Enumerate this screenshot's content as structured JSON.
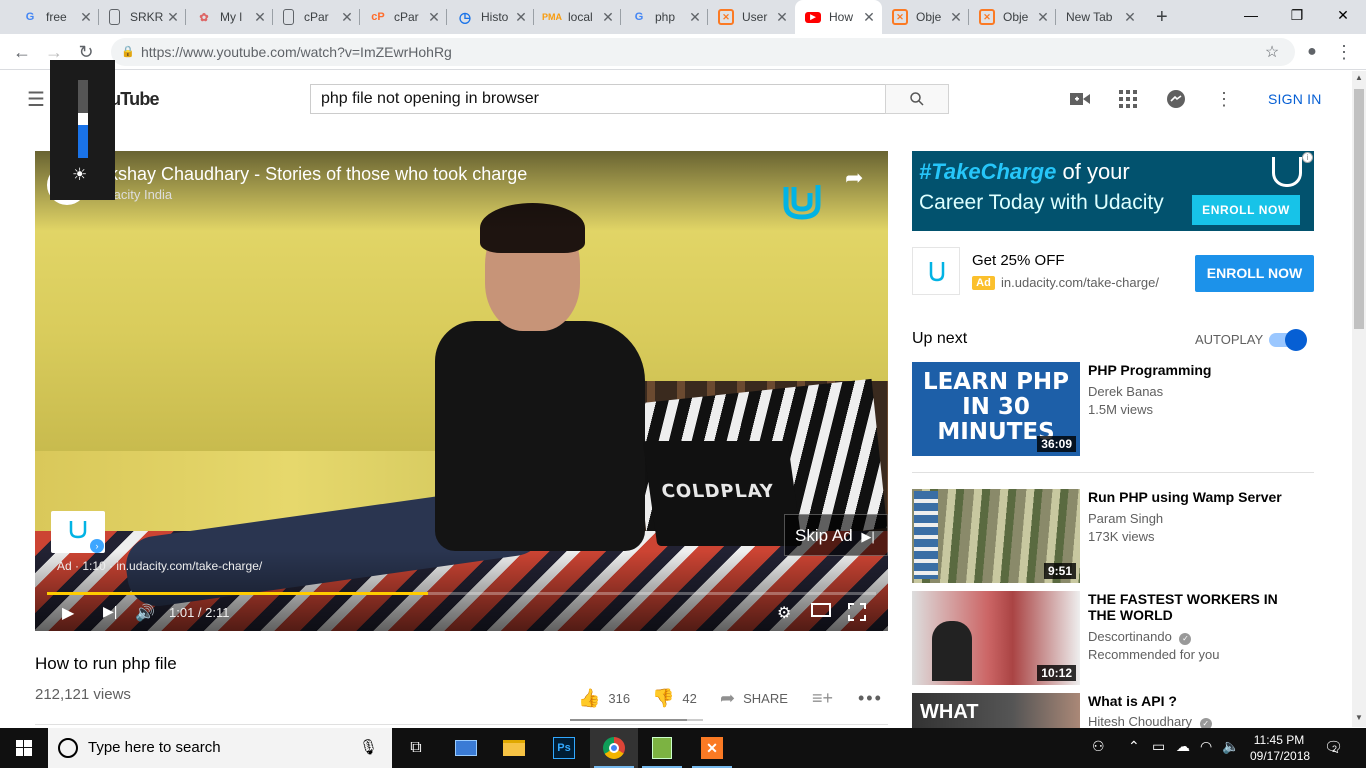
{
  "browser": {
    "tabs": [
      {
        "title": "free",
        "favicon": "google-icon"
      },
      {
        "title": "SRKR",
        "favicon": "doc-icon"
      },
      {
        "title": "My l",
        "favicon": "myicon"
      },
      {
        "title": "cPar",
        "favicon": "doc-icon"
      },
      {
        "title": "cPar",
        "favicon": "cpanel-icon"
      },
      {
        "title": "Histo",
        "favicon": "history-icon"
      },
      {
        "title": "local",
        "favicon": "phpmyadmin-icon"
      },
      {
        "title": "php",
        "favicon": "google-icon"
      },
      {
        "title": "User",
        "favicon": "xampp-icon"
      },
      {
        "title": "How",
        "favicon": "youtube-icon"
      },
      {
        "title": "Obje",
        "favicon": "xampp-icon"
      },
      {
        "title": "Obje",
        "favicon": "xampp-icon"
      },
      {
        "title": "New Tab",
        "favicon": "none"
      }
    ],
    "url": "https://www.youtube.com/watch?v=ImZEwrHohRg"
  },
  "youtube": {
    "logo_text": "YouTube",
    "search_value": "php file not opening in browser",
    "signin_label": "SIGN IN"
  },
  "player": {
    "ad_title": "Akshay Chaudhary - Stories of those who took charge",
    "ad_channel": "Udacity India",
    "skip_label": "Skip Ad",
    "ad_text": "Ad · 1:10 · in.udacity.com/take-charge/",
    "time": "1:01 / 2:11",
    "progress_fraction": 0.46
  },
  "brightness_level": 0.42,
  "video": {
    "title": "How to run php file",
    "views": "212,121 views",
    "likes": "316",
    "dislikes": "42",
    "share_label": "SHARE",
    "like_fraction": 0.88
  },
  "ad_banner": {
    "line1_hashtag": "#TakeCharge",
    "line1_rest": " of your",
    "line2": "Career Today with Udacity",
    "button": "ENROLL NOW"
  },
  "companion_ad": {
    "headline": "Get 25% OFF",
    "badge": "Ad",
    "url": "in.udacity.com/take-charge/",
    "button": "ENROLL NOW"
  },
  "sidebar": {
    "up_next_label": "Up next",
    "autoplay_label": "AUTOPLAY",
    "autoplay_on": true,
    "videos": [
      {
        "title": "PHP Programming",
        "channel": "Derek Banas",
        "views": "1.5M views",
        "duration": "36:09",
        "thumb_text": "LEARN PHP IN 30 MINUTES"
      },
      {
        "title": "Run PHP using Wamp Server",
        "channel": "Param Singh",
        "views": "173K views",
        "duration": "9:51"
      },
      {
        "title": "THE FASTEST WORKERS IN THE WORLD",
        "channel": "Descortinando",
        "views": "Recommended for you",
        "duration": "10:12"
      },
      {
        "title": "What is API ?",
        "channel": "Hitesh Choudhary",
        "thumb_text": "WHAT"
      }
    ]
  },
  "taskbar": {
    "search_placeholder": "Type here to search",
    "time": "11:45 PM",
    "date": "09/17/2018",
    "notification_count": "2"
  },
  "colors": {
    "accent": "#065fd4",
    "progress": "#ffcc00",
    "ad_badge": "#fbc02d",
    "enroll": "#1c92ea"
  }
}
